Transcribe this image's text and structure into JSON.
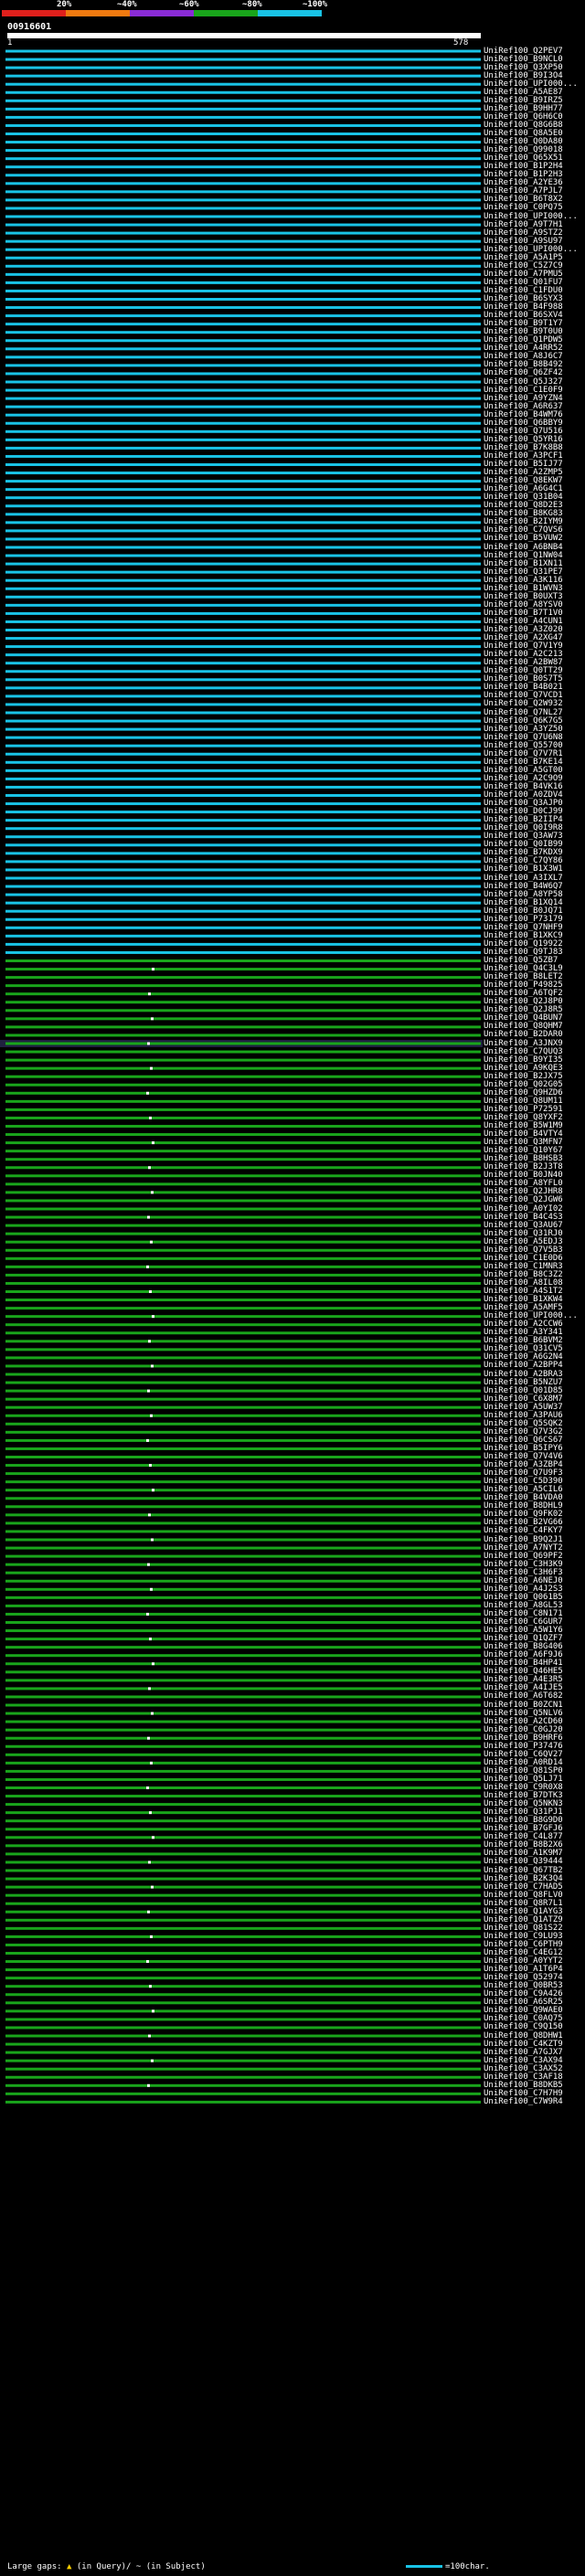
{
  "legend": [
    {
      "label": "20%",
      "color": "#e0201c"
    },
    {
      "label": "~40%",
      "color": "#f07a10"
    },
    {
      "label": "~60%",
      "color": "#8a2bd6"
    },
    {
      "label": "~80%",
      "color": "#19a51b"
    },
    {
      "label": "~100%",
      "color": "#19c3e6"
    }
  ],
  "query": {
    "name": "00916601",
    "start": "1",
    "end": "578"
  },
  "footer": {
    "large_gaps": "Large gaps:",
    "in_query": "(in Query)/",
    "in_subject": "~ (in Subject)",
    "scale_label": "=100char."
  },
  "colors": {
    "high": "#19c3e6",
    "mid": "#19a51b",
    "low": "#8a2bd6",
    "highlight": "#202040"
  },
  "hits": [
    "UniRef100_Q2PEV7",
    "UniRef100_B9NCL0",
    "UniRef100_Q3XP50",
    "UniRef100_B9I3O4",
    "UniRef100_UPI000...",
    "UniRef100_A5AE87",
    "UniRef100_B9IRZ5",
    "UniRef100_B9HH77",
    "UniRef100_Q6H6C0",
    "UniRef100_Q8G6B8",
    "UniRef100_Q8A5E0",
    "UniRef100_Q0DA80",
    "UniRef100_Q99018",
    "UniRef100_Q65X51",
    "UniRef100_B1P2H4",
    "UniRef100_B1P2H3",
    "UniRef100_A2YE36",
    "UniRef100_A7PJL7",
    "UniRef100_B6T8X2",
    "UniRef100_C0PQ75",
    "UniRef100_UPI000...",
    "UniRef100_A9T7H1",
    "UniRef100_A9STZ2",
    "UniRef100_A9SU97",
    "UniRef100_UPI000...",
    "UniRef100_A5A1P5",
    "UniRef100_C5Z7C9",
    "UniRef100_A7PMU5",
    "UniRef100_Q01FU7",
    "UniRef100_C1FDU0",
    "UniRef100_B6SYX3",
    "UniRef100_B4F988",
    "UniRef100_B6SXV4",
    "UniRef100_B9T1Y7",
    "UniRef100_B9T0U0",
    "UniRef100_Q1PDW5",
    "UniRef100_A4RR52",
    "UniRef100_A8J6C7",
    "UniRef100_B8B492",
    "UniRef100_Q6ZF42",
    "UniRef100_Q5J327",
    "UniRef100_C1E0F9",
    "UniRef100_A9YZN4",
    "UniRef100_A6R637",
    "UniRef100_B4WM76",
    "UniRef100_Q6BBY9",
    "UniRef100_Q7U516",
    "UniRef100_Q5YR16",
    "UniRef100_B7K8B8",
    "UniRef100_A3PCF1",
    "UniRef100_B5IJ77",
    "UniRef100_A2ZMP5",
    "UniRef100_Q8EKW7",
    "UniRef100_A6G4C1",
    "UniRef100_Q31B04",
    "UniRef100_Q8D2E3",
    "UniRef100_B8KG83",
    "UniRef100_B2IYM9",
    "UniRef100_C7QVS6",
    "UniRef100_B5VUW2",
    "UniRef100_A6BNB4",
    "UniRef100_Q1NW04",
    "UniRef100_B1XN11",
    "UniRef100_Q31PE7",
    "UniRef100_A3K116",
    "UniRef100_B1WVN3",
    "UniRef100_B0UXT3",
    "UniRef100_A8YSV0",
    "UniRef100_B7T1V0",
    "UniRef100_A4CUN1",
    "UniRef100_A3Z020",
    "UniRef100_A2XG47",
    "UniRef100_Q7V1Y9",
    "UniRef100_A2C213",
    "UniRef100_A2BW87",
    "UniRef100_Q0TT29",
    "UniRef100_B0S7T5",
    "UniRef100_B4B021",
    "UniRef100_Q7VCD1",
    "UniRef100_Q2W932",
    "UniRef100_Q7NL27",
    "UniRef100_Q6K7G5",
    "UniRef100_A3YZ50",
    "UniRef100_Q7U6N8",
    "UniRef100_Q55700",
    "UniRef100_Q7V7R1",
    "UniRef100_B7KE14",
    "UniRef100_A5GT00",
    "UniRef100_A2C9O9",
    "UniRef100_B4VK16",
    "UniRef100_A0ZDV4",
    "UniRef100_Q3AJP0",
    "UniRef100_D0CJ99",
    "UniRef100_B2IIP4",
    "UniRef100_Q0I9R8",
    "UniRef100_Q3AW73",
    "UniRef100_Q0IB99",
    "UniRef100_B7KDX9",
    "UniRef100_C7QY86",
    "UniRef100_B1X3W1",
    "UniRef100_A3IXL7",
    "UniRef100_B4W6Q7",
    "UniRef100_A8YP58",
    "UniRef100_B1XQ14",
    "UniRef100_B0JQ71",
    "UniRef100_P73179",
    "UniRef100_Q7NHF9",
    "UniRef100_B1XKC9",
    "UniRef100_Q19922",
    "UniRef100_Q9TJ83",
    "UniRef100_Q5ZB7",
    "UniRef100_Q4C3L9",
    "UniRef100_B8LET2",
    "UniRef100_P49825",
    "UniRef100_A6TQF2",
    "UniRef100_Q2J8P0",
    "UniRef100_Q2J8R5",
    "UniRef100_Q4BUN7",
    "UniRef100_Q8QHM7",
    "UniRef100_B2DAR0",
    "UniRef100_A3JNX9",
    "UniRef100_C7QUQ3",
    "UniRef100_B9YI35",
    "UniRef100_A9KQE3",
    "UniRef100_B2JX75",
    "UniRef100_Q02G05",
    "UniRef100_Q9HZD6",
    "UniRef100_Q8UM11",
    "UniRef100_P72591",
    "UniRef100_Q8YXF2",
    "UniRef100_B5W1M9",
    "UniRef100_B4VTY4",
    "UniRef100_Q3MFN7",
    "UniRef100_Q10Y67",
    "UniRef100_B8HSB3",
    "UniRef100_B2J3T8",
    "UniRef100_B0JN40",
    "UniRef100_A8YFL0",
    "UniRef100_Q2JHR8",
    "UniRef100_Q2JGW6",
    "UniRef100_A0YI02",
    "UniRef100_B4C4S3",
    "UniRef100_Q3AU67",
    "UniRef100_Q31RJ0",
    "UniRef100_A5EDJ3",
    "UniRef100_Q7V5B3",
    "UniRef100_C1E0D6",
    "UniRef100_C1MNR3",
    "UniRef100_B8C3Z2",
    "UniRef100_A8IL08",
    "UniRef100_A4S1T2",
    "UniRef100_B1XKW4",
    "UniRef100_A5AMF5",
    "UniRef100_UPI000...",
    "UniRef100_A2CCW6",
    "UniRef100_A3Y341",
    "UniRef100_B6BVM2",
    "UniRef100_Q31CV5",
    "UniRef100_A6G2N4",
    "UniRef100_A2BPP4",
    "UniRef100_A2BRA3",
    "UniRef100_B5NZU7",
    "UniRef100_Q01D85",
    "UniRef100_C6X8M7",
    "UniRef100_A5UW37",
    "UniRef100_A3PAU6",
    "UniRef100_Q5SQK2",
    "UniRef100_Q7V3G2",
    "UniRef100_Q6CS67",
    "UniRef100_B5IPY6",
    "UniRef100_Q7V4V6",
    "UniRef100_A3ZBP4",
    "UniRef100_Q7U9F3",
    "UniRef100_C5D390",
    "UniRef100_A5CIL6",
    "UniRef100_B4VDA0",
    "UniRef100_B8DHL9",
    "UniRef100_Q9FK02",
    "UniRef100_B2VG66",
    "UniRef100_C4FKY7",
    "UniRef100_B9Q2J1",
    "UniRef100_A7NYT2",
    "UniRef100_Q69PF2",
    "UniRef100_C3H3K9",
    "UniRef100_C3H6F3",
    "UniRef100_A6NEJ0",
    "UniRef100_A4J2S3",
    "UniRef100_Q061B5",
    "UniRef100_A8GL53",
    "UniRef100_C8N171",
    "UniRef100_C6GUR7",
    "UniRef100_A5W1Y6",
    "UniRef100_Q1QZF7",
    "UniRef100_B8G406",
    "UniRef100_A6F9J6",
    "UniRef100_B4HP41",
    "UniRef100_Q46HE5",
    "UniRef100_A4E3R5",
    "UniRef100_A4IJE5",
    "UniRef100_A6T682",
    "UniRef100_B0ZCN1",
    "UniRef100_Q5NLV6",
    "UniRef100_A2CD60",
    "UniRef100_C0GJ20",
    "UniRef100_B9HRF6",
    "UniRef100_P37476",
    "UniRef100_C6QV27",
    "UniRef100_A0RD14",
    "UniRef100_Q81SP0",
    "UniRef100_Q5LJ71",
    "UniRef100_C9R0X8",
    "UniRef100_B7DTK3",
    "UniRef100_Q5NKN3",
    "UniRef100_Q31PJ1",
    "UniRef100_B8G9D0",
    "UniRef100_B7GFJ6",
    "UniRef100_C4L877",
    "UniRef100_B8B2X6",
    "UniRef100_A1K9M7",
    "UniRef100_Q39444",
    "UniRef100_Q67TB2",
    "UniRef100_B2K3Q4",
    "UniRef100_C7HAD5",
    "UniRef100_Q8FLV0",
    "UniRef100_Q8R7L1",
    "UniRef100_Q1AYG3",
    "UniRef100_Q1ATZ9",
    "UniRef100_Q81S22",
    "UniRef100_C9LU93",
    "UniRef100_C6PTH9",
    "UniRef100_C4EG12",
    "UniRef100_A0YYT2",
    "UniRef100_A1T6P4",
    "UniRef100_Q52974",
    "UniRef100_Q0BR53",
    "UniRef100_C9A426",
    "UniRef100_A6SR25",
    "UniRef100_Q9WAE0",
    "UniRef100_C0AQ75",
    "UniRef100_C9Q150",
    "UniRef100_Q8DHW1",
    "UniRef100_C4KZT9",
    "UniRef100_A7GJX7",
    "UniRef100_C3AX94",
    "UniRef100_C3AX52",
    "UniRef100_C3AF18",
    "UniRef100_B8DKB5",
    "UniRef100_C7H7H9",
    "UniRef100_C7W9R4"
  ]
}
